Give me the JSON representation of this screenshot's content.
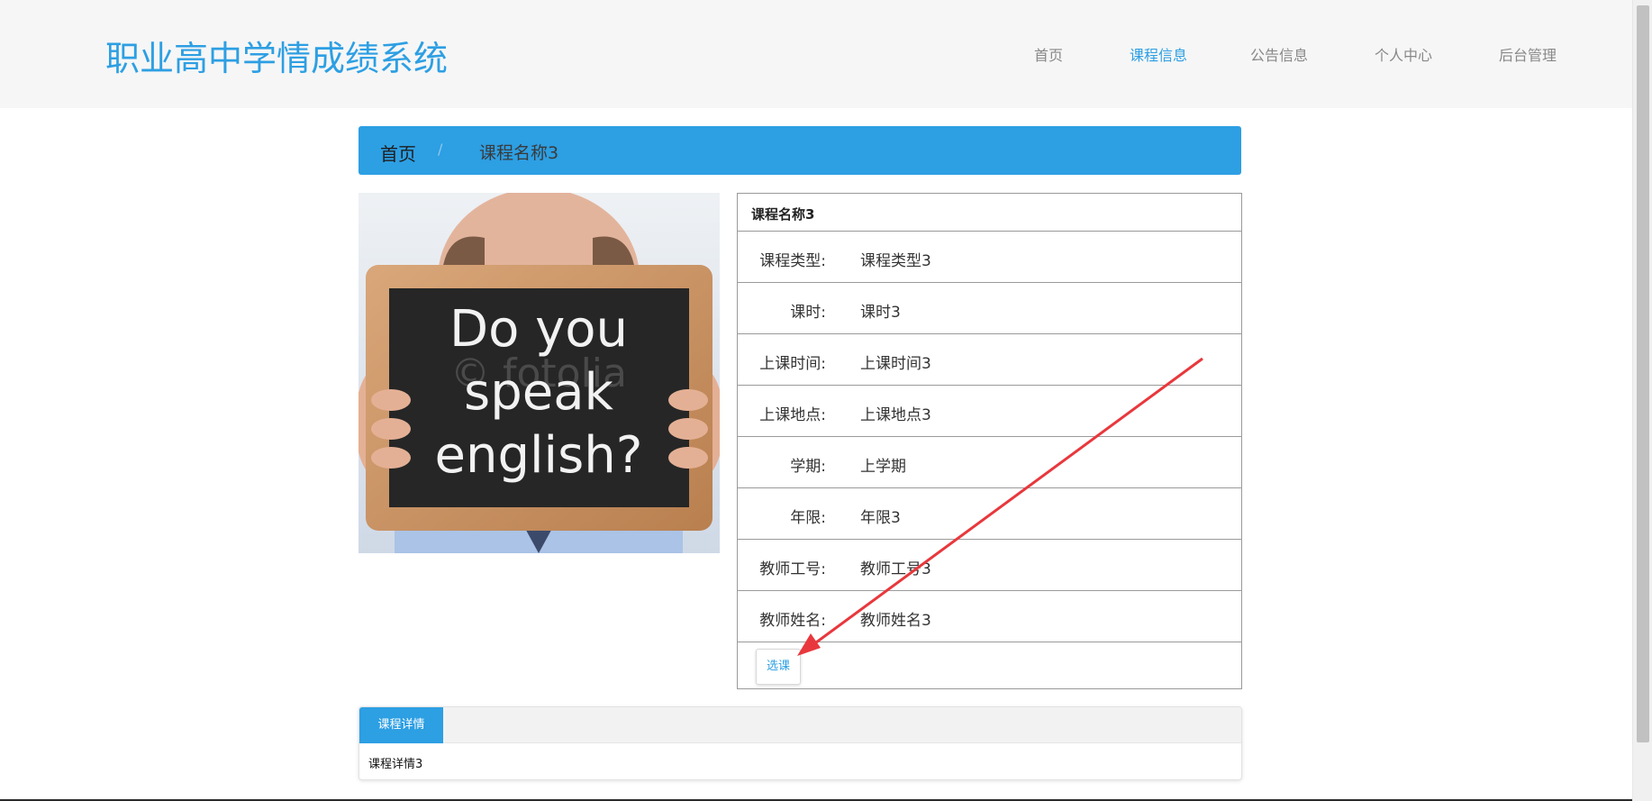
{
  "header": {
    "site_title": "职业高中学情成绩系统",
    "nav": [
      {
        "label": "首页",
        "active": false
      },
      {
        "label": "课程信息",
        "active": true
      },
      {
        "label": "公告信息",
        "active": false
      },
      {
        "label": "个人中心",
        "active": false
      },
      {
        "label": "后台管理",
        "active": false
      }
    ]
  },
  "breadcrumb": {
    "home": "首页",
    "separator": "/",
    "current": "课程名称3"
  },
  "course": {
    "image_text": [
      "Do you",
      "speak",
      "english?"
    ],
    "image_watermark": "© fotolia",
    "title": "课程名称3",
    "fields": [
      {
        "label": "课程类型:",
        "value": "课程类型3"
      },
      {
        "label": "课时:",
        "value": "课时3"
      },
      {
        "label": "上课时间:",
        "value": "上课时间3"
      },
      {
        "label": "上课地点:",
        "value": "上课地点3"
      },
      {
        "label": "学期:",
        "value": "上学期"
      },
      {
        "label": "年限:",
        "value": "年限3"
      },
      {
        "label": "教师工号:",
        "value": "教师工号3"
      },
      {
        "label": "教师姓名:",
        "value": "教师姓名3"
      }
    ],
    "select_button": "选课"
  },
  "details": {
    "tab_label": "课程详情",
    "content": "课程详情3"
  },
  "colors": {
    "accent": "#2d9fe3",
    "header_bg": "#f6f6f6",
    "annotation_arrow": "#e8383d"
  }
}
